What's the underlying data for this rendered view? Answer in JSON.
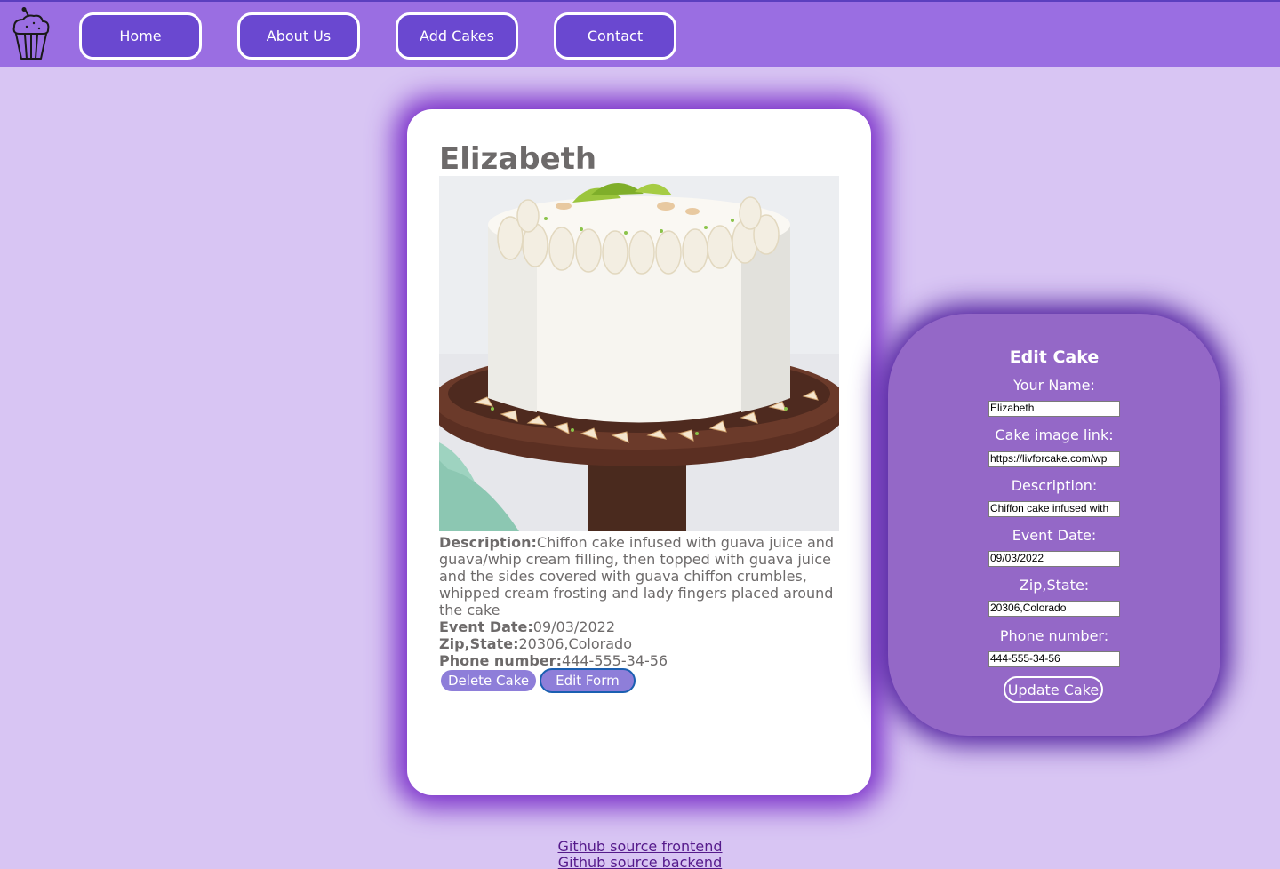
{
  "nav": {
    "logo_icon": "cupcake-icon",
    "items": [
      {
        "label": "Home"
      },
      {
        "label": "About Us"
      },
      {
        "label": "Add Cakes"
      },
      {
        "label": "Contact"
      }
    ]
  },
  "cake_card": {
    "name": "Elizabeth",
    "image_alt": "white frosted cake on wooden stand",
    "description_label": "Description:",
    "description": "Chiffon cake infused with guava juice and guava/whip cream filling, then topped with guava juice and the sides covered with guava chiffon crumbles, whipped cream frosting and lady fingers placed around the cake",
    "event_date_label": "Event Date:",
    "event_date": "09/03/2022",
    "zip_state_label": "Zip,State:",
    "zip_state": "20306,Colorado",
    "phone_label": "Phone number:",
    "phone": "444-555-34-56",
    "delete_label": "Delete Cake",
    "edit_label": "Edit Form"
  },
  "edit_form": {
    "title": "Edit Cake",
    "fields": [
      {
        "label": "Your Name:",
        "value": "Elizabeth"
      },
      {
        "label": "Cake image link:",
        "value": "https://livforcake.com/wp"
      },
      {
        "label": "Description:",
        "value": "Chiffon cake infused with"
      },
      {
        "label": "Event Date:",
        "value": "09/03/2022"
      },
      {
        "label": "Zip,State:",
        "value": "20306,Colorado"
      },
      {
        "label": "Phone number:",
        "value": "444-555-34-56"
      }
    ],
    "submit_label": "Update Cake"
  },
  "footer": {
    "frontend_link": "Github source frontend",
    "backend_link": "Github source backend"
  },
  "colors": {
    "page_bg": "#d8c5f3",
    "navbar_bg": "#9a6ee2",
    "nav_button_bg": "#6a48d0",
    "card_glow": "#7a2fc9",
    "edit_panel_bg": "#9468c7",
    "pill_button_bg": "#8e7ed9"
  }
}
